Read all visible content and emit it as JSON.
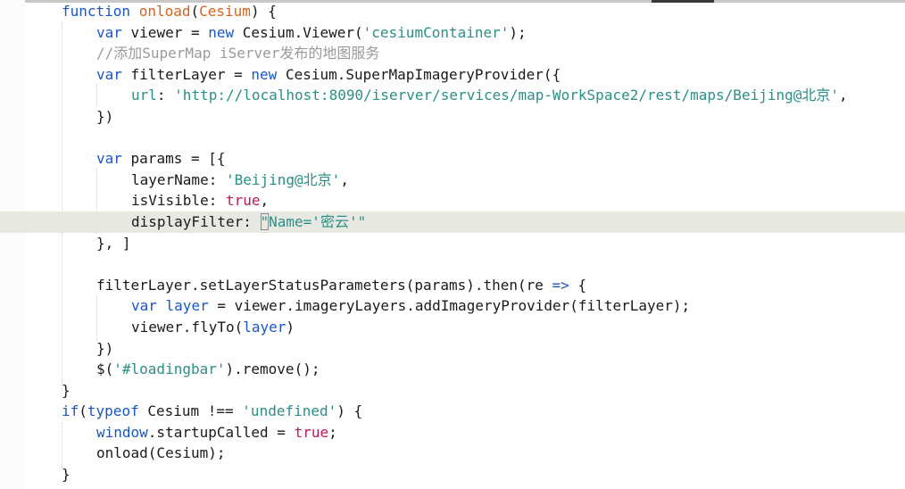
{
  "colors": {
    "keyword": "#1b57c4",
    "function": "#d8621a",
    "string": "#2b8f86",
    "comment": "#9a9a9a",
    "boolean": "#c2185b",
    "text": "#1a1a1a",
    "current_line": "#e8e8e2"
  },
  "code": {
    "l1": {
      "kw": "function",
      "fn": "onload",
      "open": "(",
      "fn2": "Cesium",
      "close": ") {"
    },
    "l2": {
      "kw": "var",
      "t1": " viewer = ",
      "kw2": "new",
      "t2": " Cesium.Viewer(",
      "s1": "'cesiumContainer'",
      "t3": ");"
    },
    "l3": {
      "comment": "//添加SuperMap iServer发布的地图服务"
    },
    "l4": {
      "kw": "var",
      "t1": " filterLayer = ",
      "kw2": "new",
      "t2": " Cesium.SuperMapImageryProvider({"
    },
    "l5": {
      "key": "url",
      "t1": ": ",
      "s1": "'http://localhost:8090/iserver/services/map-WorkSpace2/rest/maps/Beijing@北京'",
      "t2": ","
    },
    "l6": {
      "t1": "})"
    },
    "l7": {
      "t1": ""
    },
    "l8": {
      "kw": "var",
      "t1": " params = [{"
    },
    "l9": {
      "t1": "layerName: ",
      "s1": "'Beijing@北京'",
      "t2": ","
    },
    "l10": {
      "t1": "isVisible: ",
      "b1": "true",
      "t2": ","
    },
    "l11": {
      "t1": "displayFilter: ",
      "q1": "\"",
      "s1": "Name='密云'",
      "q2": "\""
    },
    "l12": {
      "t1": "}, ]"
    },
    "l13": {
      "t1": ""
    },
    "l14": {
      "t1": "filterLayer.setLayerStatusParameters(params).then(re ",
      "kw": "=>",
      "t2": " {"
    },
    "l15": {
      "kw": "var",
      "fn": " layer",
      "t1": " = viewer.imageryLayers.addImageryProvider(filterLayer);"
    },
    "l16": {
      "t1": "viewer.flyTo(",
      "fn": "layer",
      "t2": ")"
    },
    "l17": {
      "t1": "})"
    },
    "l18": {
      "t1": "$(",
      "s1": "'#loadingbar'",
      "t2": ").remove();"
    },
    "l19": {
      "t1": "}"
    },
    "l20": {
      "kw": "if",
      "t1": "(",
      "kw2": "typeof",
      "t2": " Cesium !== ",
      "s1": "'undefined'",
      "t3": ") {"
    },
    "l21": {
      "kw": "window",
      "t1": ".startupCalled = ",
      "b1": "true",
      "t2": ";"
    },
    "l22": {
      "t1": "onload(Cesium);"
    },
    "l23": {
      "t1": "}"
    }
  }
}
